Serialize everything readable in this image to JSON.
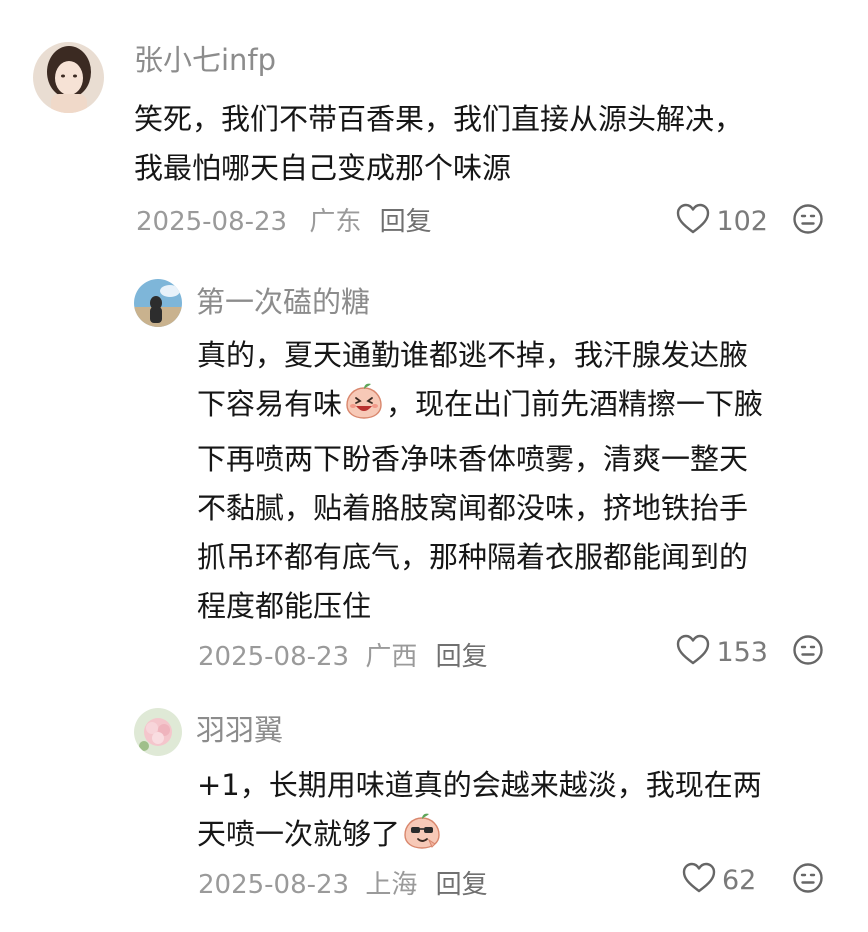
{
  "comments": [
    {
      "username": "张小七infp",
      "text_lines": [
        "笑死，我们不带百香果，我们直接从源头解决，",
        "我最怕哪天自己变成那个味源"
      ],
      "date": "2025-08-23",
      "region": "广东",
      "reply_label": "回复",
      "likes": "102"
    },
    {
      "username": "第一次磕的糖",
      "text_lines": [
        "真的，夏天通勤谁都逃不掉，我汗腺发达腋",
        "下容易有味",
        "，现在出门前先酒精擦一下腋",
        "下再喷两下盼香净味香体喷雾，清爽一整天",
        "不黏腻，贴着胳肢窝闻都没味，挤地铁抬手",
        "抓吊环都有底气，那种隔着衣服都能闻到的",
        "程度都能压住"
      ],
      "date": "2025-08-23",
      "region": "广西",
      "reply_label": "回复",
      "likes": "153"
    },
    {
      "username": "羽羽翼",
      "text_lines": [
        "+1，长期用味道真的会越来越淡，我现在两",
        "天喷一次就够了"
      ],
      "date": "2025-08-23",
      "region": "上海",
      "reply_label": "回复",
      "likes": "62"
    }
  ],
  "icons": {
    "like": "heart-outline-icon",
    "dislike": "meh-face-icon",
    "emoji_1": "laughing-peach-emoji",
    "emoji_2": "cool-peach-emoji"
  },
  "colors": {
    "username": "#8c8c8c",
    "body": "#161616",
    "meta": "#9a9a9a",
    "icon": "#666666"
  }
}
